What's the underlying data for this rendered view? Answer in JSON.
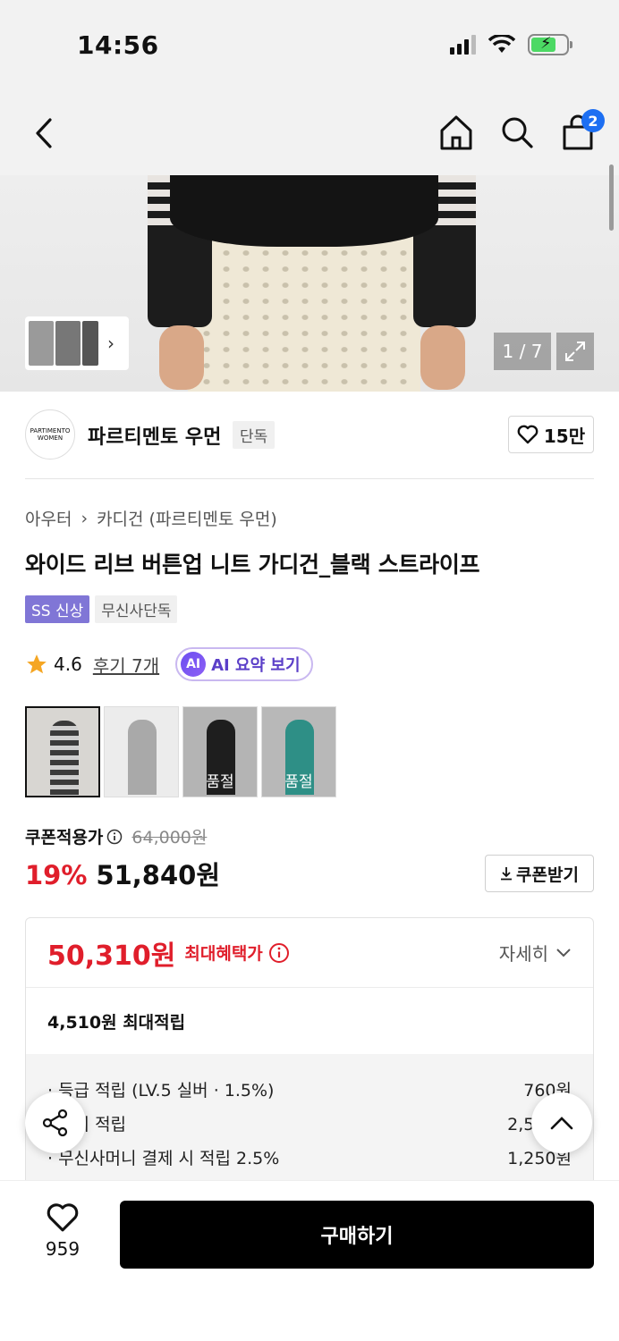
{
  "status": {
    "time": "14:56"
  },
  "nav": {
    "cart_count": "2"
  },
  "hero": {
    "counter": "1 / 7"
  },
  "brand": {
    "logo_text": "PARTIMENTO WOMEN",
    "name": "파르티멘토 우먼",
    "badge": "단독",
    "likes": "15만"
  },
  "breadcrumb": {
    "level1": "아우터",
    "level2": "카디건 (파르티멘토 우먼)"
  },
  "product": {
    "title": "와이드 리브 버튼업 니트 가디건_블랙 스트라이프",
    "tags": [
      "SS 신상",
      "무신사단독"
    ]
  },
  "rating": {
    "score": "4.6",
    "reviews": "후기 7개",
    "ai_icon": "AI",
    "ai_label": "AI 요약 보기"
  },
  "variants": [
    {
      "color": "#3a3a3a",
      "sold_out": ""
    },
    {
      "color": "#a9a9a9",
      "sold_out": ""
    },
    {
      "color": "#1e1e1e",
      "sold_out": "품절"
    },
    {
      "color": "#2e8f86",
      "sold_out": "품절"
    }
  ],
  "price": {
    "coupon_label": "쿠폰적용가",
    "original": "64,000원",
    "discount": "19%",
    "sale": "51,840원",
    "coupon_button": "쿠폰받기"
  },
  "benefit": {
    "max_price": "50,310원",
    "max_label": "최대혜택가",
    "detail": "자세히",
    "max_points": "4,510원 최대적립",
    "items": [
      {
        "label": "· 등급 적립 (LV.5 실버 · 1.5%)",
        "value": "760원"
      },
      {
        "label": "· 후기 적립",
        "value": "2,500원"
      },
      {
        "label": "· 무신사머니 결제 시 적립 2.5%",
        "value": "1,250원"
      }
    ]
  },
  "bottom": {
    "wish_count": "959",
    "buy": "구매하기"
  },
  "colors": {
    "accent": "#e01e2b",
    "badge_blue": "#1d6ff2",
    "tag_purple": "#8076d6"
  }
}
